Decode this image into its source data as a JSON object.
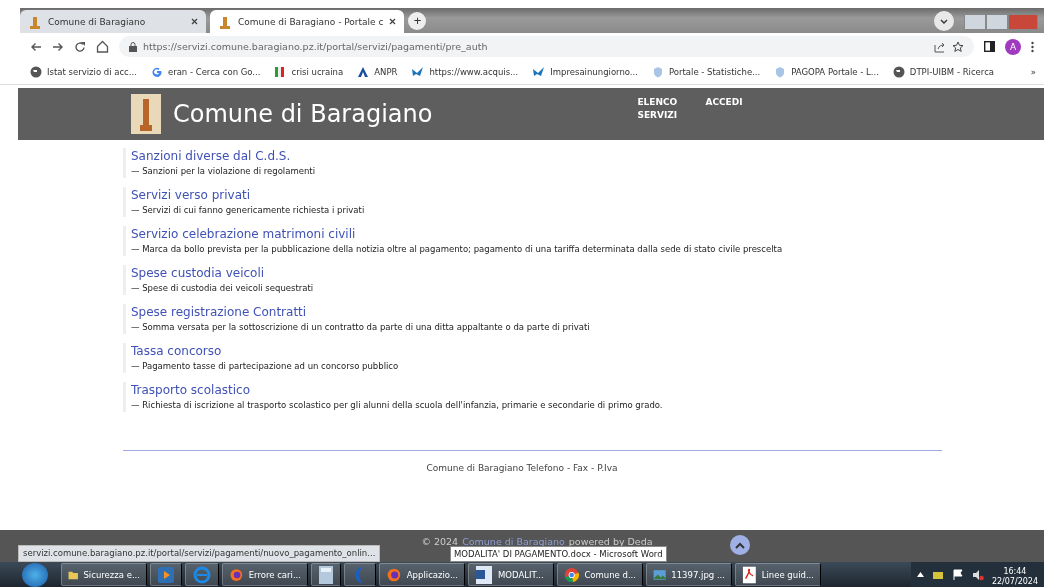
{
  "tabs": [
    {
      "title": "Comune di Baragiano",
      "selected": false
    },
    {
      "title": "Comune di Baragiano - Portale c",
      "selected": true
    }
  ],
  "new_tab": "+",
  "address_bar": {
    "url": "https://servizi.comune.baragiano.pz.it/portal/servizi/pagamenti/pre_auth"
  },
  "profile": "A",
  "bookmarks": [
    {
      "label": "Istat servizio di acc...",
      "kind": "globe"
    },
    {
      "label": "eran - Cerca con Go...",
      "kind": "google"
    },
    {
      "label": "crisi ucraina",
      "kind": "flag"
    },
    {
      "label": "ANPR",
      "kind": "anpr"
    },
    {
      "label": "https://www.acquis...",
      "kind": "bird"
    },
    {
      "label": "Impresainungiorno...",
      "kind": "bird"
    },
    {
      "label": "Portale - Statistiche...",
      "kind": "shield"
    },
    {
      "label": "PAGOPA Portale - L...",
      "kind": "shield"
    },
    {
      "label": "DTPI-UIBM - Ricerca",
      "kind": "globe"
    }
  ],
  "bookmarks_more": "»",
  "site": {
    "title": "Comune di Baragiano",
    "nav": [
      "ELENCO SERVIZI",
      "ACCEDI"
    ]
  },
  "services": [
    {
      "title": "Sanzioni diverse dal C.d.S.",
      "description": "— Sanzioni per la violazione di regolamenti"
    },
    {
      "title": "Servizi verso privati",
      "description": "— Servizi di cui fanno genericamente richiesta i privati"
    },
    {
      "title": "Servizio celebrazione matrimoni civili",
      "description": "— Marca da bollo prevista per la pubblicazione della notizia oltre al pagamento; pagamento di una tariffa determinata dalla sede di stato civile prescelta"
    },
    {
      "title": "Spese custodia veicoli",
      "description": "— Spese di custodia dei veicoli sequestrati"
    },
    {
      "title": "Spese registrazione Contratti",
      "description": "— Somma versata per la sottoscrizione di un contratto da parte di una ditta appaltante o da parte di privati"
    },
    {
      "title": "Tassa concorso",
      "description": "— Pagamento tasse di partecipazione ad un concorso pubblico"
    },
    {
      "title": "Trasporto scolastico",
      "description": "— Richiesta di iscrizione al trasporto scolastico per gli alunni della scuola dell'infanzia, primarie e secondarie di primo grado."
    }
  ],
  "footer": {
    "contacts": "Comune di Baragiano Telefono - Fax - P.Iva",
    "copyright": "© 2024",
    "copyright_link": "Comune di Baragiano",
    "copyright_suffix": "powered by Deda"
  },
  "status_url": "servizi.comune.baragiano.pz.it/portal/servizi/pagamenti/nuovo_pagamento_onlin...",
  "tooltip": "MODALITA' DI PAGAMENTO.docx - Microsoft Word",
  "taskbar": [
    {
      "label": "Sicurezza e...",
      "kind": "folder"
    },
    {
      "kind": "media"
    },
    {
      "kind": "ie"
    },
    {
      "label": "Errore cari...",
      "kind": "firefox"
    },
    {
      "kind": "calculator"
    },
    {
      "kind": "moon"
    },
    {
      "label": "Applicazio...",
      "kind": "firefox"
    },
    {
      "label": "MODALIT...",
      "kind": "word"
    },
    {
      "label": "Comune d...",
      "kind": "chrome"
    },
    {
      "label": "11397.jpg ...",
      "kind": "image"
    },
    {
      "label": "Linee guid...",
      "kind": "pdf"
    }
  ],
  "clock": {
    "time": "16:44",
    "date": "22/07/2024"
  }
}
